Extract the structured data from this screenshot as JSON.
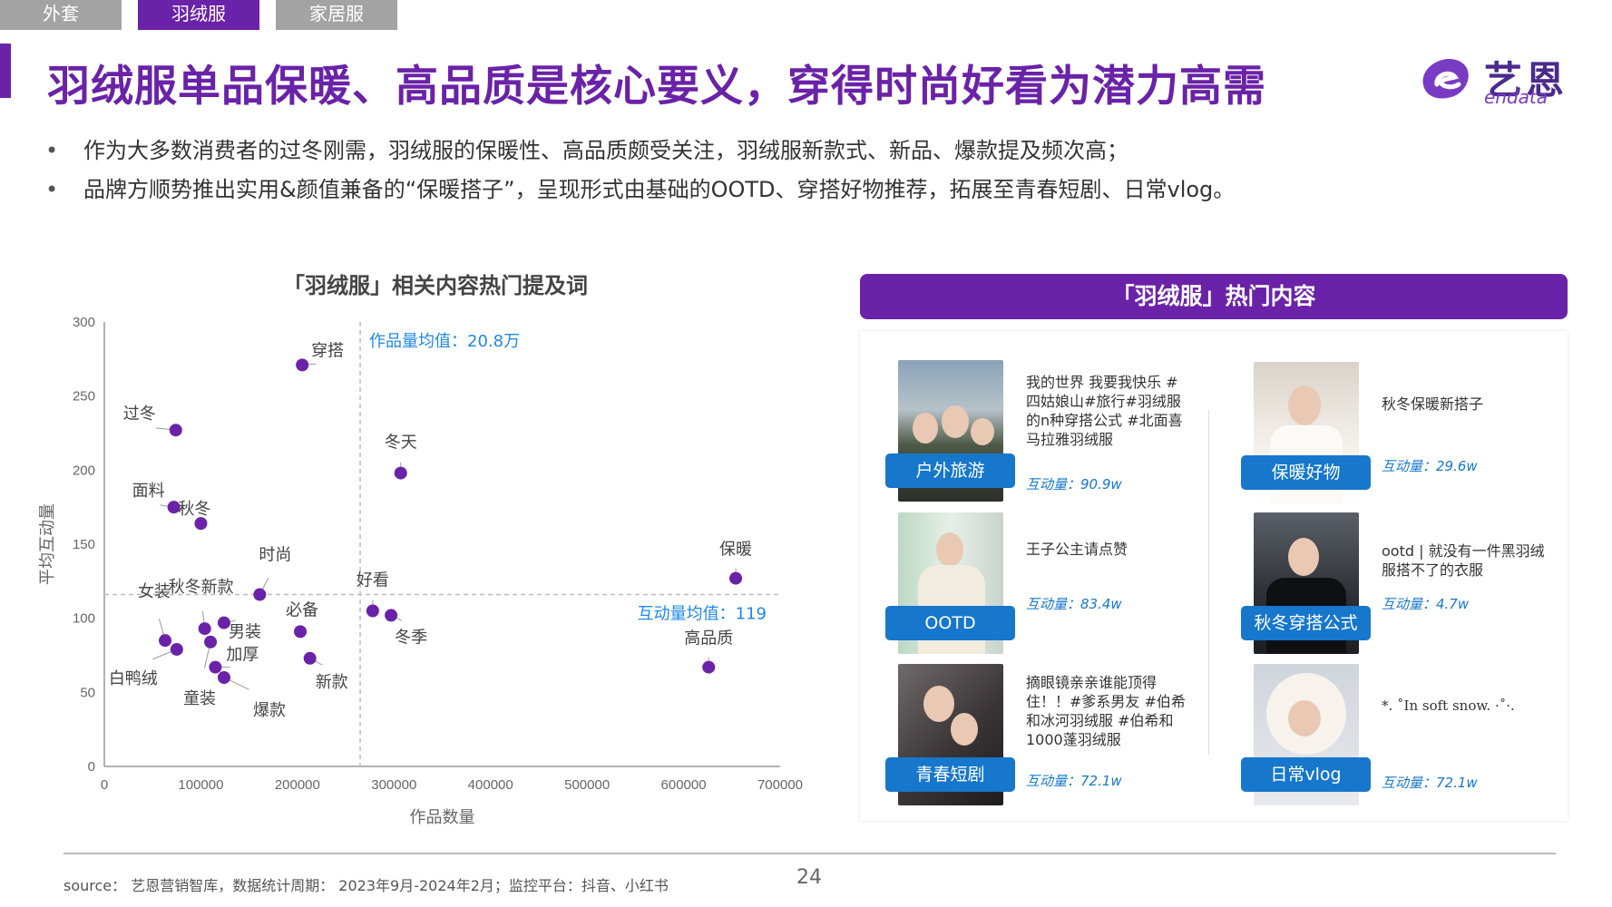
{
  "tabs": [
    {
      "label": "外套",
      "active": false
    },
    {
      "label": "羽绒服",
      "active": true
    },
    {
      "label": "家居服",
      "active": false
    }
  ],
  "title": "羽绒服单品保暖、高品质是核心要义，穿得时尚好看为潜力高需",
  "logo": {
    "cn": "艺恩",
    "en": "endata"
  },
  "bullets": [
    "作为大多数消费者的过冬刚需，羽绒服的保暖性、高品质颇受关注，羽绒服新款式、新品、爆款提及频次高；",
    "品牌方顺势推出实用&颜值兼备的“保暖搭子”，呈现形式由基础的OOTD、穿搭好物推荐，拓展至青春短剧、日常vlog。"
  ],
  "chart_title": "「羽绒服」相关内容热门提及词",
  "chart_data": {
    "type": "scatter",
    "title": "「羽绒服」相关内容热门提及词",
    "xlabel": "作品数量",
    "ylabel": "平均互动量",
    "xlim": [
      0,
      700000
    ],
    "ylim": [
      0,
      300
    ],
    "xticks": [
      0,
      100000,
      200000,
      300000,
      400000,
      500000,
      600000,
      700000
    ],
    "yticks": [
      0,
      50,
      100,
      150,
      200,
      250,
      300
    ],
    "x_mean": 265000,
    "y_mean": 116,
    "x_mean_label": "作品量均值：20.8万",
    "y_mean_label": "互动量均值：119",
    "color": "#6a22a8",
    "points": [
      {
        "label": "穿搭",
        "x": 205000,
        "y": 271
      },
      {
        "label": "过冬",
        "x": 74000,
        "y": 227
      },
      {
        "label": "冬天",
        "x": 307000,
        "y": 198
      },
      {
        "label": "面料",
        "x": 72000,
        "y": 175
      },
      {
        "label": "秋冬",
        "x": 100000,
        "y": 164
      },
      {
        "label": "保暖",
        "x": 654000,
        "y": 127
      },
      {
        "label": "时尚",
        "x": 161000,
        "y": 116
      },
      {
        "label": "秋冬新款",
        "x": 104000,
        "y": 93
      },
      {
        "label": "女装",
        "x": 63000,
        "y": 85
      },
      {
        "label": "好看",
        "x": 278000,
        "y": 105
      },
      {
        "label": "冬季",
        "x": 297000,
        "y": 102
      },
      {
        "label": "必备",
        "x": 203000,
        "y": 91
      },
      {
        "label": "男装",
        "x": 124000,
        "y": 97
      },
      {
        "label": "高品质",
        "x": 626000,
        "y": 67
      },
      {
        "label": "白鸭绒",
        "x": 75000,
        "y": 79
      },
      {
        "label": "加厚",
        "x": 115000,
        "y": 67
      },
      {
        "label": "新款",
        "x": 213000,
        "y": 73
      },
      {
        "label": "爆款",
        "x": 124000,
        "y": 60
      },
      {
        "label": "童装",
        "x": 110000,
        "y": 84
      }
    ]
  },
  "panel": {
    "header": "「羽绒服」热门内容",
    "metric_prefix": "互动量：",
    "cards": [
      {
        "tag": "户外旅游",
        "desc": "我的世界 我要我快乐 #四姑娘山#旅行#羽绒服的n种穿搭公式 #北面喜马拉雅羽绒服",
        "metric": "互动量：90.9w"
      },
      {
        "tag": "保暖好物",
        "desc": "秋冬保暖新搭子",
        "metric": "互动量：29.6w"
      },
      {
        "tag": "OOTD",
        "desc": "王子公主请点赞",
        "metric": "互动量：83.4w"
      },
      {
        "tag": "秋冬穿搭公式",
        "desc": "ootd | 就没有一件黑羽绒服搭不了的衣服",
        "metric": "互动量：4.7w"
      },
      {
        "tag": "青春短剧",
        "desc": "摘眼镜亲亲谁能顶得住！！#爹系男友 #伯希和冰河羽绒服 #伯希和1000蓬羽绒服",
        "metric": "互动量：72.1w"
      },
      {
        "tag": "日常vlog",
        "desc": "*. ˚In soft snow. ·˚·.",
        "metric": "互动量：72.1w"
      }
    ]
  },
  "source": "source： 艺恩营销智库，数据统计周期： 2023年9月-2024年2月；监控平台：抖音、小红书",
  "page_number": "24"
}
